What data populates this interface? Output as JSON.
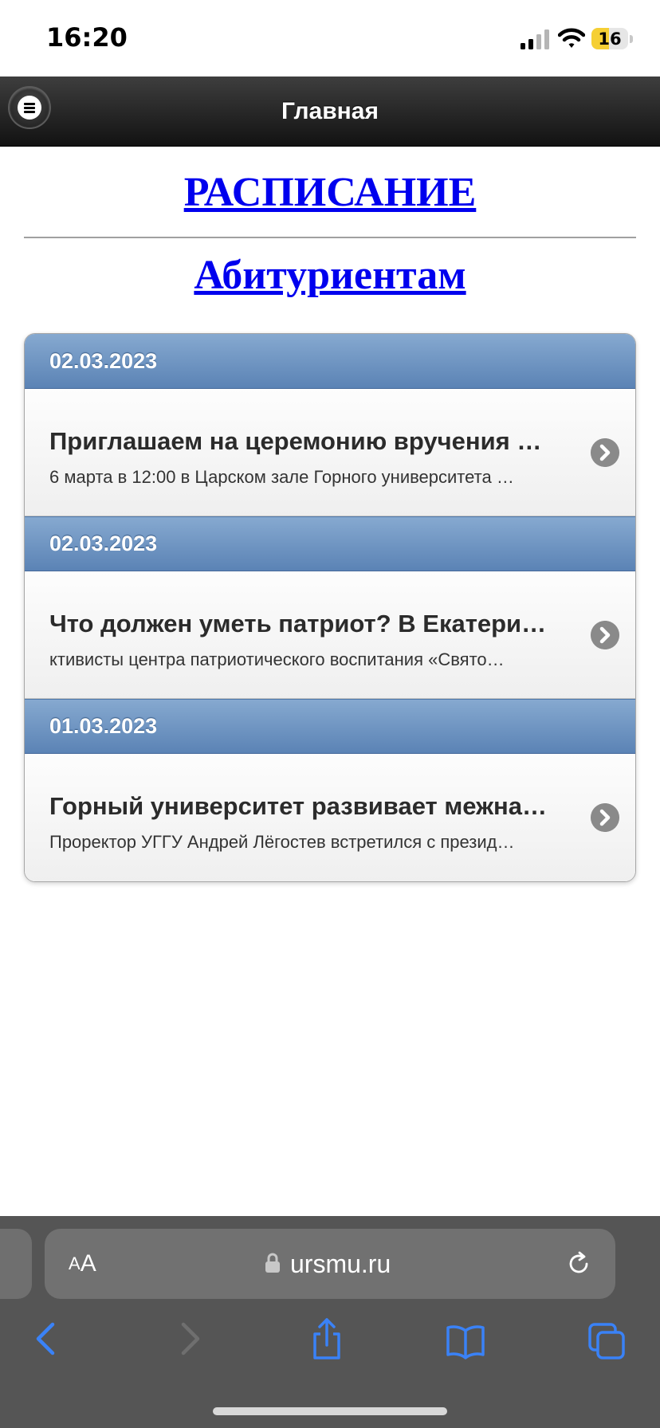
{
  "status_bar": {
    "time": "16:20",
    "battery_level": "16",
    "battery_fill_fraction": 0.16
  },
  "header": {
    "title": "Главная",
    "menu_icon": "hamburger-menu-icon"
  },
  "links": {
    "schedule": "РАСПИСАНИЕ",
    "applicants": "Абитуриентам"
  },
  "news": [
    {
      "date": "02.03.2023",
      "title": "Приглашаем на церемонию вручения …",
      "description": "6 марта в 12:00 в Царском зале Горного университета …"
    },
    {
      "date": "02.03.2023",
      "title": "Что должен уметь патриот? В Екатери…",
      "description": "ктивисты центра патриотического воспитания «Свято…"
    },
    {
      "date": "01.03.2023",
      "title": "Горный университет развивает межна…",
      "description": "Проректор УГГУ Андрей Лёгостев встретился с презид…"
    }
  ],
  "browser": {
    "aa_small": "A",
    "aa_big": "A",
    "url": "ursmu.ru"
  },
  "colors": {
    "header_dark": "#121212",
    "date_divider_blue": "#5b83b5",
    "link_blue": "#0000ee",
    "safari_toolbar": "#555555",
    "safari_icon_blue": "#3a82f7"
  }
}
